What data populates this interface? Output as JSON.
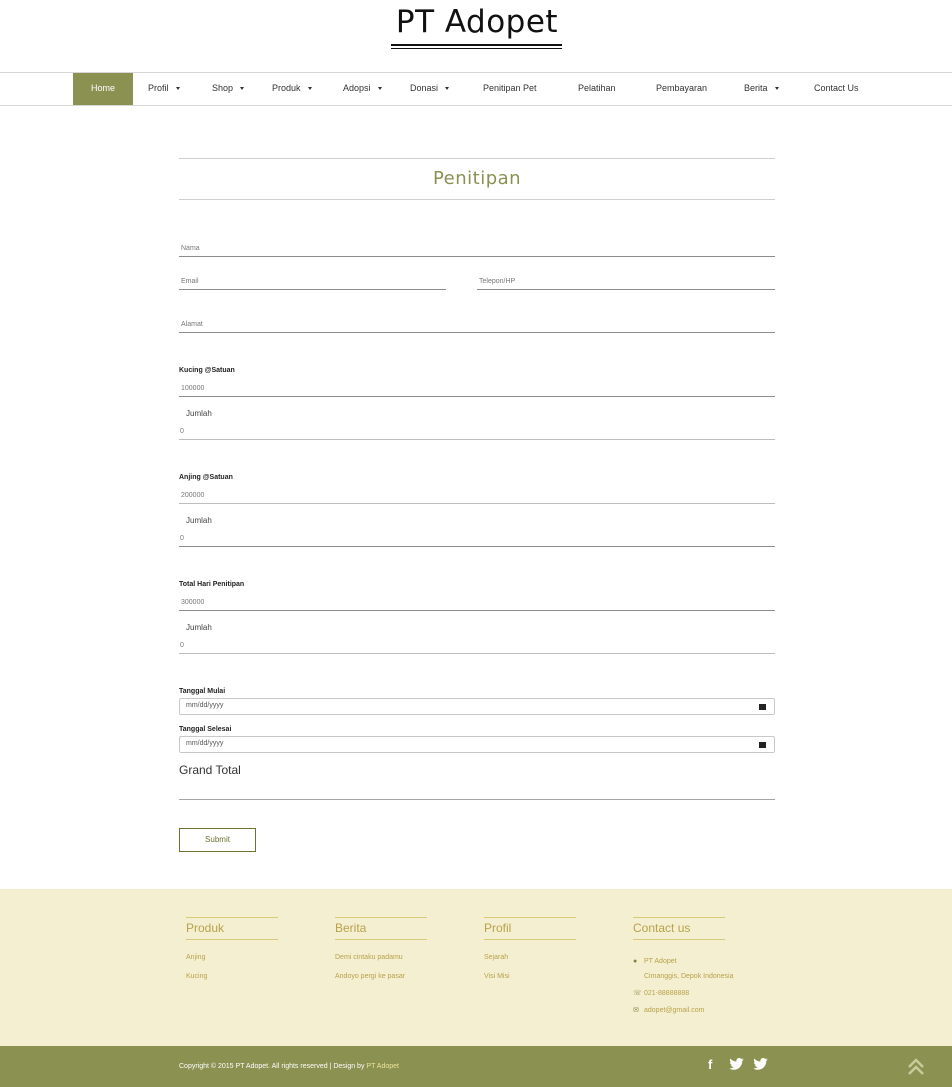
{
  "brand": {
    "logo": "PT Adopet"
  },
  "nav": {
    "items": [
      {
        "label": "Home",
        "active": true,
        "dropdown": false
      },
      {
        "label": "Profil",
        "dropdown": true
      },
      {
        "label": "Shop",
        "dropdown": true
      },
      {
        "label": "Produk",
        "dropdown": true
      },
      {
        "label": "Adopsi",
        "dropdown": true
      },
      {
        "label": "Donasi",
        "dropdown": true
      },
      {
        "label": "Penitipan Pet",
        "dropdown": false
      },
      {
        "label": "Pelatihan",
        "dropdown": false
      },
      {
        "label": "Pembayaran",
        "dropdown": false
      },
      {
        "label": "Berita",
        "dropdown": true
      },
      {
        "label": "Contact Us",
        "dropdown": false
      }
    ]
  },
  "form": {
    "title": "Penitipan",
    "nama_placeholder": "Nama",
    "email_placeholder": "Email",
    "telepon_placeholder": "Telepon/HP",
    "alamat_placeholder": "Alamat",
    "kucing": {
      "label": "Kucing @Satuan",
      "price": "100000",
      "jumlah_label": "Jumlah",
      "jumlah_value": "0"
    },
    "anjing": {
      "label": "Anjing @Satuan",
      "price": "200000",
      "jumlah_label": "Jumlah",
      "jumlah_value": "0"
    },
    "hari": {
      "label": "Total Hari Penitipan",
      "price": "300000",
      "jumlah_label": "Jumlah",
      "jumlah_value": "0"
    },
    "tanggal_mulai": {
      "label": "Tanggal Mulai",
      "placeholder": "mm/dd/yyyy"
    },
    "tanggal_selesai": {
      "label": "Tanggal Selesai",
      "placeholder": "mm/dd/yyyy"
    },
    "grand_total_label": "Grand Total",
    "submit_label": "Submit"
  },
  "footer": {
    "produk": {
      "heading": "Produk",
      "links": [
        "Anjing",
        "Kucing"
      ]
    },
    "berita": {
      "heading": "Berita",
      "links": [
        "Demi cintaku padamu",
        "Andoyo pergi ke pasar"
      ]
    },
    "profil": {
      "heading": "Profil",
      "links": [
        "Sejarah",
        "Visi Misi"
      ]
    },
    "contact": {
      "heading": "Contact us",
      "company": "PT Adopet",
      "address": "Cimanggis, Depok Indonesia",
      "phone": "021-88888888",
      "email": "adopet@gmail.com"
    },
    "copyright": "Copyright © 2015 PT Adopet. All rights reserved | Design by",
    "designer": "PT Adopet",
    "social": {
      "facebook": "f",
      "twitter1": "🐦",
      "twitter2": "🐦"
    },
    "colors": {
      "bar": "#8a9151",
      "bg": "#f5efd2",
      "accent": "#b7a24a"
    }
  }
}
